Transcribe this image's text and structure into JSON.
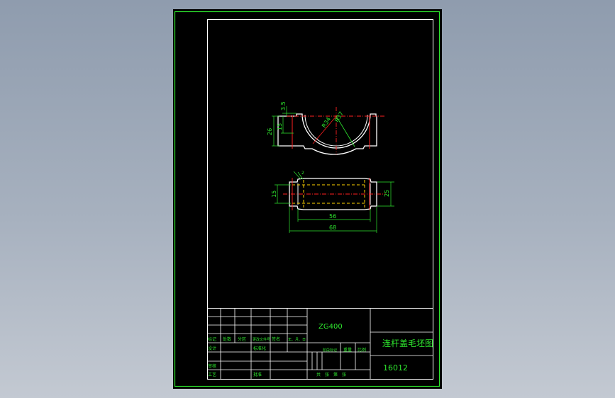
{
  "drawing": {
    "title": "连杆盖毛坯图",
    "number": "16012",
    "material": "ZG400"
  },
  "title_block": {
    "row_labels": [
      "标记",
      "处数",
      "分区",
      "更改文件号",
      "签名",
      "年、月、日"
    ],
    "design": "设计",
    "standardize": "标准化",
    "stage_mark": "阶段标记",
    "weight": "重量",
    "scale": "比例",
    "review": "审核",
    "process": "工艺",
    "approve": "批准",
    "sheets": "共　张　第　张"
  },
  "dimensions": {
    "d_top": "3.5",
    "d_left_inner": "15",
    "d_left_outer": "26",
    "d_radius_a": "R34",
    "d_radius_b": "R37",
    "d_chamfer": "2",
    "d_side_left": "15",
    "d_side_right": "25",
    "d_len_inner": "56",
    "d_len_outer": "68"
  },
  "colors": {
    "background": "#000000",
    "frame": "#2ee62e",
    "outline": "#ffffff",
    "centerline": "#ff2020",
    "hidden": "#ffd400",
    "dimension": "#2ee62e"
  }
}
